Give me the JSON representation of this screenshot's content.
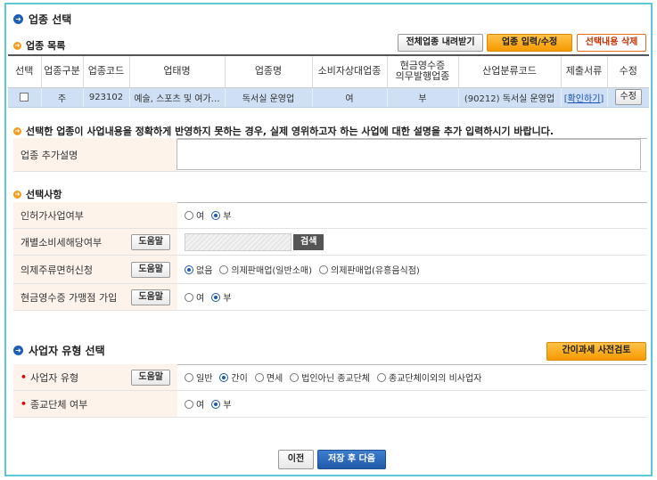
{
  "header": {
    "title": "업종 선택"
  },
  "list_section": {
    "title": "업종 목록",
    "buttons": {
      "download": "전체업종 내려받기",
      "input_edit": "업종 입력/수정",
      "delete": "선택내용 삭제"
    },
    "columns": [
      "선택",
      "업종구분",
      "업종코드",
      "업태명",
      "업종명",
      "소비자상대업종",
      "현금영수증\n의무발행업종",
      "산업분류코드",
      "제출서류",
      "수정"
    ],
    "rows": [
      {
        "type": "주",
        "code": "923102",
        "business_type": "예술, 스포츠 및 여가…",
        "industry": "독서실 운영업",
        "consumer": "여",
        "cash_receipt": "부",
        "industry_code": "(90212) 독서실 운영업",
        "docs": "[확인하기]",
        "edit": "수정"
      }
    ]
  },
  "notice": "선택한 업종이 사업내용을 정확하게 반영하지 못하는 경우, 실제 영위하고자 하는 사업에 대한 설명을 추가 입력하시기 바랍니다.",
  "extra_desc": {
    "label": "업종 추가설명",
    "value": ""
  },
  "selections": {
    "title": "선택사항",
    "help_label": "도움말",
    "rows": [
      {
        "label": "인허가사업여부",
        "options": [
          "여",
          "부"
        ],
        "selected": 1,
        "help": false
      },
      {
        "label": "개별소비세해당여부",
        "help": true,
        "search_label": "검색"
      },
      {
        "label": "의제주류면허신청",
        "options": [
          "없음",
          "의제판매업(일반소매)",
          "의제판매업(유흥음식점)"
        ],
        "selected": 0,
        "help": true
      },
      {
        "label": "현금영수증 가맹점 가입",
        "options": [
          "여",
          "부"
        ],
        "selected": 1,
        "help": true
      }
    ]
  },
  "biz_type": {
    "title": "사업자 유형 선택",
    "precheck_button": "간이과세 사전검토",
    "rows": [
      {
        "label": "사업자 유형",
        "options": [
          "일반",
          "간이",
          "면세",
          "법인아닌 종교단체",
          "종교단체이외의 비사업자"
        ],
        "selected": 1,
        "help": true
      },
      {
        "label": "종교단체 여부",
        "options": [
          "여",
          "부"
        ],
        "selected": 1,
        "help": false
      }
    ]
  },
  "footer": {
    "prev": "이전",
    "save_next": "저장 후 다음"
  },
  "colors": {
    "frame": "#5cc8d6",
    "row_selected": "#cfe0f5",
    "label_bg": "#fdf3ea",
    "accent_orange": "#f59a00",
    "accent_blue": "#1f5aa8"
  }
}
